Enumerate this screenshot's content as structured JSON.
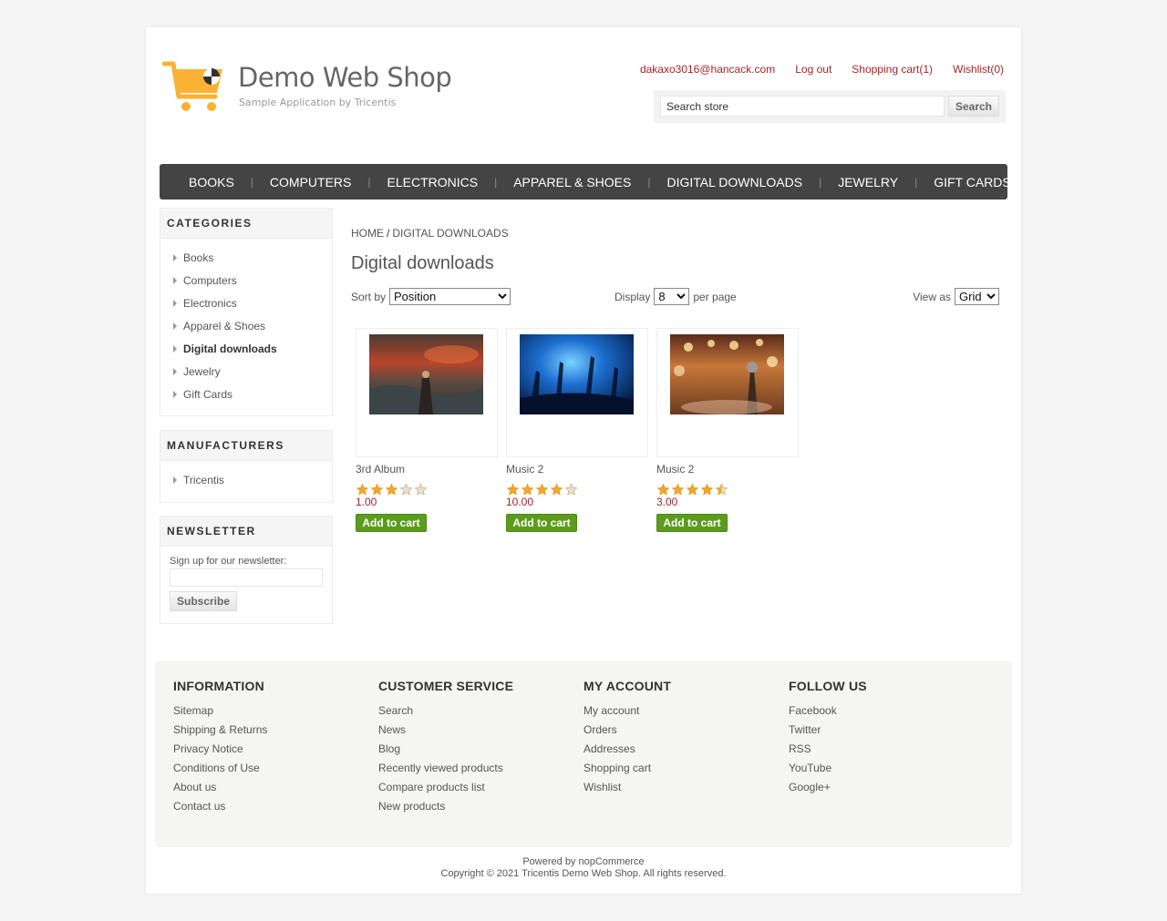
{
  "header": {
    "logo_title": "Demo Web Shop",
    "logo_subtitle": "Sample Application by Tricentis",
    "user_email": "dakaxo3016@hancack.com",
    "logout": "Log out",
    "cart": "Shopping cart(1)",
    "wishlist": "Wishlist(0)",
    "search_placeholder": "Search store",
    "search_button": "Search"
  },
  "menu": [
    "BOOKS",
    "COMPUTERS",
    "ELECTRONICS",
    "APPAREL & SHOES",
    "DIGITAL DOWNLOADS",
    "JEWELRY",
    "GIFT CARDS"
  ],
  "categories": {
    "title": "CATEGORIES",
    "items": [
      "Books",
      "Computers",
      "Electronics",
      "Apparel & Shoes",
      "Digital downloads",
      "Jewelry",
      "Gift Cards"
    ],
    "active": "Digital downloads"
  },
  "manufacturers": {
    "title": "MANUFACTURERS",
    "items": [
      "Tricentis"
    ]
  },
  "newsletter": {
    "title": "NEWSLETTER",
    "label": "Sign up for our newsletter:",
    "button": "Subscribe"
  },
  "breadcrumb": {
    "home": "HOME",
    "current": "DIGITAL DOWNLOADS"
  },
  "page_title": "Digital downloads",
  "toolbar": {
    "sort_label": "Sort by",
    "sort_value": "Position",
    "display_label": "Display",
    "display_value": "8",
    "per_page": "per page",
    "view_label": "View as",
    "view_value": "Grid"
  },
  "products": [
    {
      "name": "3rd Album",
      "rating": 3,
      "price": "1.00",
      "button": "Add to cart"
    },
    {
      "name": "Music 2",
      "rating": 4,
      "price": "10.00",
      "button": "Add to cart"
    },
    {
      "name": "Music 2",
      "rating": 4.5,
      "price": "3.00",
      "button": "Add to cart"
    }
  ],
  "footer": {
    "information": {
      "title": "INFORMATION",
      "links": [
        "Sitemap",
        "Shipping & Returns",
        "Privacy Notice",
        "Conditions of Use",
        "About us",
        "Contact us"
      ]
    },
    "customer_service": {
      "title": "CUSTOMER SERVICE",
      "links": [
        "Search",
        "News",
        "Blog",
        "Recently viewed products",
        "Compare products list",
        "New products"
      ]
    },
    "my_account": {
      "title": "MY ACCOUNT",
      "links": [
        "My account",
        "Orders",
        "Addresses",
        "Shopping cart",
        "Wishlist"
      ]
    },
    "follow_us": {
      "title": "FOLLOW US",
      "links": [
        "Facebook",
        "Twitter",
        "RSS",
        "YouTube",
        "Google+"
      ]
    },
    "powered_by": "Powered by nopCommerce",
    "copyright": "Copyright © 2021 Tricentis Demo Web Shop. All rights reserved."
  },
  "colors": {
    "link_red": "#a2262a",
    "menu_bg": "#444444",
    "button_green": "#5c9c1c",
    "star": "#f5a623",
    "logo_orange": "#f9b233"
  }
}
